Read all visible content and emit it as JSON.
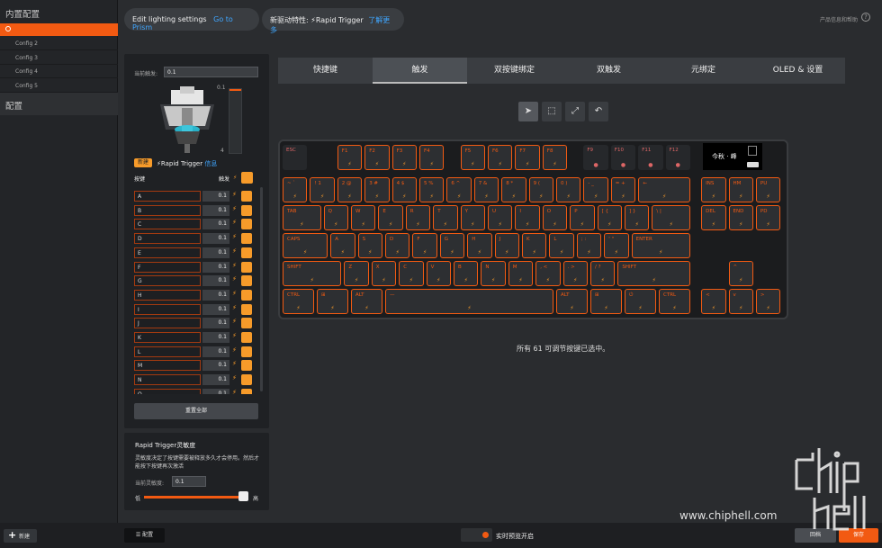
{
  "sidebar": {
    "title": "内置配置",
    "configs": [
      "Config 2",
      "Config 3",
      "Config 4",
      "Config 5"
    ],
    "section": "配置",
    "new_label": "新建"
  },
  "top": {
    "edit_label": "Edit lighting settings",
    "prism_link": "Go to Prism",
    "feature_label": "新驱动特性: ⚡Rapid Trigger",
    "learn_more": "了解更多",
    "help": "产品信息和帮助"
  },
  "left": {
    "current_label": "当前触发:",
    "current_value": "0.1",
    "range_top": "0.1",
    "range_bottom": "4",
    "badge": "新建",
    "rt_label": "⚡Rapid Trigger",
    "rt_info": "信息",
    "keys_label": "按键",
    "trigger_label": "触发",
    "reset_all": "重置全部",
    "keys": [
      {
        "name": "A",
        "value": "0.1"
      },
      {
        "name": "B",
        "value": "0.1"
      },
      {
        "name": "C",
        "value": "0.1"
      },
      {
        "name": "D",
        "value": "0.1"
      },
      {
        "name": "E",
        "value": "0.1"
      },
      {
        "name": "F",
        "value": "0.1"
      },
      {
        "name": "G",
        "value": "0.1"
      },
      {
        "name": "H",
        "value": "0.1"
      },
      {
        "name": "I",
        "value": "0.1"
      },
      {
        "name": "J",
        "value": "0.1"
      },
      {
        "name": "K",
        "value": "0.1"
      },
      {
        "name": "L",
        "value": "0.1"
      },
      {
        "name": "M",
        "value": "0.1"
      },
      {
        "name": "N",
        "value": "0.1"
      },
      {
        "name": "O",
        "value": "0.1"
      }
    ]
  },
  "sensitivity": {
    "title": "Rapid Trigger灵敏度",
    "desc": "灵敏度决定了按键需要被释放多久才会停用。然后才能按下按键再次激活",
    "current_label": "当前灵敏度:",
    "current_value": "0.1",
    "low": "低",
    "high": "高",
    "level": 1.0
  },
  "tabs": [
    "快捷键",
    "触发",
    "双按键绑定",
    "双触发",
    "元绑定",
    "OLED & 设置"
  ],
  "active_tab": "触发",
  "tools": [
    "cursor-icon",
    "select-box-icon",
    "expand-icon",
    "undo-icon"
  ],
  "keyboard": {
    "oled_text": "今秋 · 峰",
    "status": "所有 61 可调节按键已选中。",
    "rows": [
      [
        "ESC",
        "F1",
        "F2",
        "F3",
        "F4",
        "F5",
        "F6",
        "F7",
        "F8",
        "F9",
        "F10",
        "F11",
        "F12"
      ],
      [
        "~ `",
        "! 1",
        "2 @",
        "3 #",
        "4 $",
        "5 %",
        "6 ^",
        "7 &",
        "8 *",
        "9 (",
        "0 )",
        "- _",
        "= +",
        "←",
        "INS",
        "HM",
        "PU"
      ],
      [
        "TAB",
        "Q",
        "W",
        "E",
        "R",
        "T",
        "Y",
        "U",
        "I",
        "O",
        "P",
        "[ {",
        "] }",
        "\\ |",
        "DEL",
        "END",
        "PD"
      ],
      [
        "CAPS",
        "A",
        "S",
        "D",
        "F",
        "G",
        "H",
        "J",
        "K",
        "L",
        "; :",
        "' \"",
        "ENTER"
      ],
      [
        "SHIFT",
        "Z",
        "X",
        "C",
        "V",
        "B",
        "N",
        "M",
        ", <",
        ". >",
        "/ ?",
        "SHIFT",
        "^"
      ],
      [
        "CTRL",
        "⊞",
        "ALT",
        "—",
        "ALT",
        "⊞",
        "⏻",
        "CTRL",
        "<",
        "v",
        ">"
      ]
    ]
  },
  "bottom": {
    "profile": "配置",
    "live_preview": "实时预览开启",
    "revert": "回档",
    "save": "保存"
  },
  "watermark": {
    "text": "www.chiphell.com"
  },
  "colors": {
    "accent": "#f25a12",
    "gold": "#f79b2a",
    "link": "#3fa6ff"
  }
}
